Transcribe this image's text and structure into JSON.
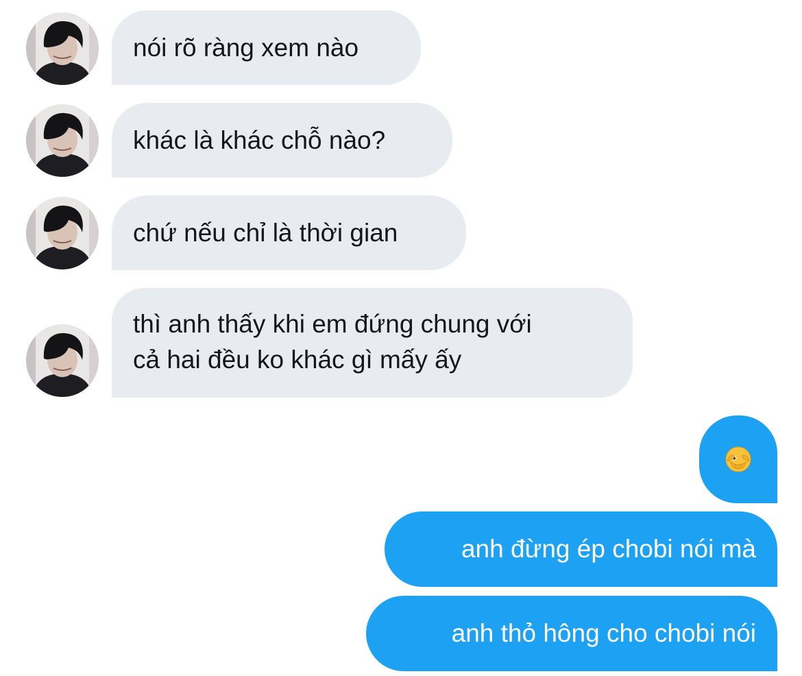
{
  "conversation": {
    "incoming": [
      {
        "text": "nói rõ ràng xem nào"
      },
      {
        "text": "khác là khác chỗ nào?"
      },
      {
        "text": "chứ nếu chỉ là thời gian"
      },
      {
        "lines": [
          "thì anh thấy khi em đứng chung với",
          "cả hai đều ko khác gì mấy ấy"
        ]
      }
    ],
    "outgoing": [
      {
        "emoji": "face-with-hand-over-mouth-peeking-emoji"
      },
      {
        "text": "anh đừng ép chobi nói mà"
      },
      {
        "text": "anh thỏ hông cho chobi nói"
      }
    ],
    "avatar_icon": "user-avatar-photo",
    "colors": {
      "incoming_bubble": "#e8ecf0",
      "incoming_text": "#14171a",
      "outgoing_bubble": "#1da1f2",
      "outgoing_text": "#ffffff",
      "background": "#ffffff"
    }
  }
}
